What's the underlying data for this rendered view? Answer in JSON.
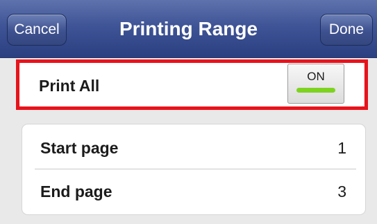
{
  "navbar": {
    "cancel_label": "Cancel",
    "title": "Printing Range",
    "done_label": "Done"
  },
  "print_all": {
    "label": "Print All",
    "toggle_state": "ON",
    "toggle_on": true,
    "highlighted": true
  },
  "pages": {
    "start": {
      "label": "Start page",
      "value": "1"
    },
    "end": {
      "label": "End page",
      "value": "3"
    }
  },
  "colors": {
    "navbar": "#3f5496",
    "highlight": "#e8131b",
    "toggle_on": "#7ed321",
    "background": "#e9e9ea"
  }
}
